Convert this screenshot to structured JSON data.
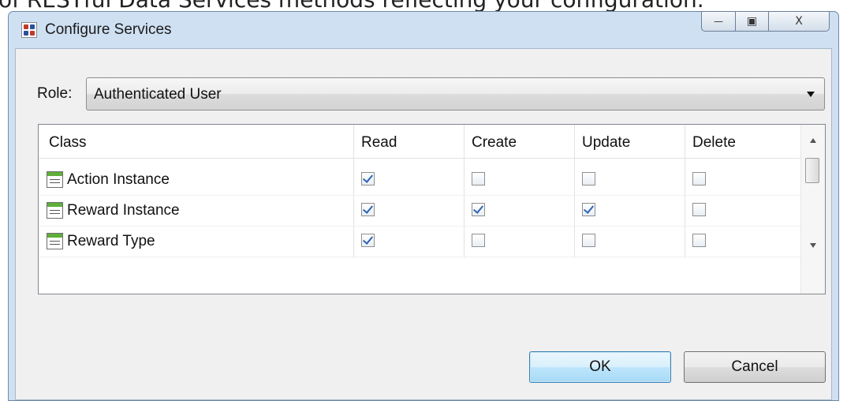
{
  "background_caption": "of RESTful Data Services methods reflecting your configuration.",
  "window": {
    "title": "Configure Services",
    "buttons": {
      "minimize": "—",
      "maximize": "▣",
      "close": "X"
    }
  },
  "role": {
    "label": "Role:",
    "selected": "Authenticated User"
  },
  "table": {
    "columns": [
      "Class",
      "Read",
      "Create",
      "Update",
      "Delete"
    ],
    "rows": [
      {
        "name": "Action Instance",
        "read": true,
        "create": false,
        "update": false,
        "delete": false
      },
      {
        "name": "Reward Instance",
        "read": true,
        "create": true,
        "update": true,
        "delete": false
      },
      {
        "name": "Reward Type",
        "read": true,
        "create": false,
        "update": false,
        "delete": false
      }
    ]
  },
  "buttons": {
    "ok": "OK",
    "cancel": "Cancel"
  },
  "colors": {
    "titlebar": "#cfe0f2",
    "client": "#f0f0f0",
    "check": "#2c64b4",
    "class_icon_header": "#5fae3a",
    "ok_border": "#3c7fb1"
  },
  "icons": {
    "app": "app-icon",
    "class": "class-entity-icon",
    "checkbox": "checkbox-icon",
    "combo": "chevron-down-icon"
  }
}
